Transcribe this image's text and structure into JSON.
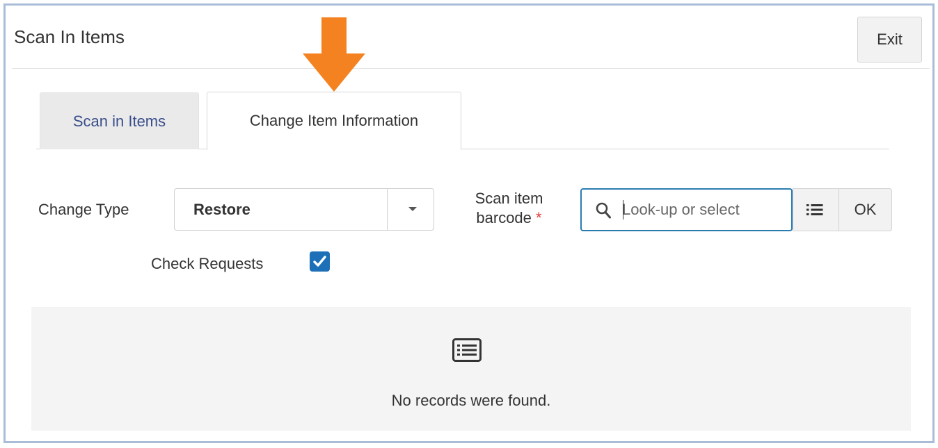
{
  "window": {
    "title": "Scan In Items",
    "exit_label": "Exit"
  },
  "tabs": [
    {
      "label": "Scan in Items",
      "active": false
    },
    {
      "label": "Change Item Information",
      "active": true
    }
  ],
  "form": {
    "change_type_label": "Change Type",
    "change_type_value": "Restore",
    "scan_label_line1": "Scan item",
    "scan_label_line2": "barcode",
    "required_marker": "*",
    "search_placeholder": "Look-up or select",
    "ok_label": "OK",
    "check_requests_label": "Check Requests",
    "check_requests_checked": true
  },
  "results": {
    "empty_message": "No records were found."
  },
  "icons": {
    "annotation": "orange-down-arrow",
    "search": "magnifier-icon",
    "list": "list-icon",
    "empty": "list-card-icon",
    "checkbox": "checkmark-icon"
  },
  "colors": {
    "frame_border": "#a9bcd8",
    "arrow": "#f58220",
    "checkbox": "#1d6fb8",
    "search_border": "#2a7bb0",
    "required": "#e03a3a",
    "inactive_tab_text": "#3a4e8a"
  }
}
